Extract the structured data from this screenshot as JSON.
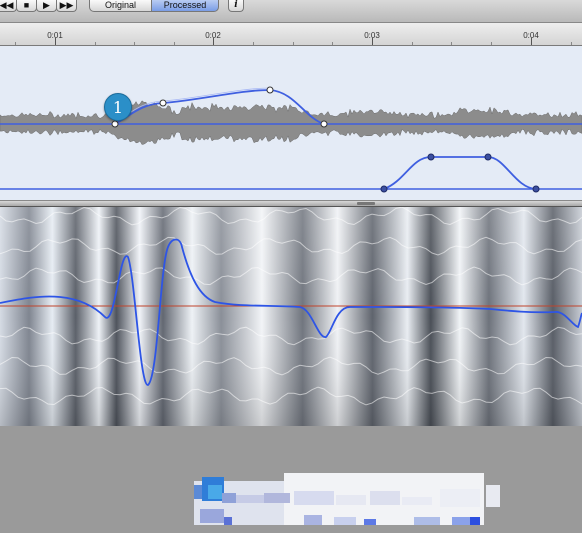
{
  "toolbar": {
    "rewind_icon": "rewind-icon",
    "stop_icon": "stop-icon",
    "play_icon": "play-icon",
    "forward_icon": "fast-forward-icon",
    "original_label": "Original",
    "processed_label": "Processed",
    "info_label": "i"
  },
  "ruler": {
    "labels": [
      "0:01",
      "0:02",
      "0:03",
      "0:04"
    ]
  },
  "callout": {
    "number": "1"
  },
  "colors": {
    "envelope_bg": "#e4ebf6",
    "curve": "#3f5fe0",
    "waveform": "#8c8c8c",
    "pitch_line": "#2e55e6",
    "reference_line": "#c0442c",
    "badge": "#2b8fc8",
    "processed_button": "#8fa9ea"
  }
}
